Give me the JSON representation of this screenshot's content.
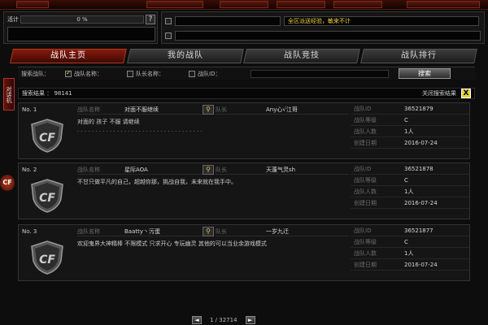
{
  "status": {
    "name_label": "活计",
    "percent": "0 %",
    "help_label": "?",
    "speaker_text": "全区派送经验，敏来不计"
  },
  "tabs": [
    {
      "label": "战队主页",
      "active": true
    },
    {
      "label": "我的战队",
      "active": false
    },
    {
      "label": "战队竞技",
      "active": false
    },
    {
      "label": "战队排行",
      "active": false
    }
  ],
  "side_tab": "对讲机",
  "side_icon": "CF",
  "filter": {
    "label": "搜索战队：",
    "options": [
      {
        "label": "战队名称：",
        "checked": true
      },
      {
        "label": "队长名称：",
        "checked": false
      },
      {
        "label": "战队ID：",
        "checked": false
      }
    ],
    "search_button": "搜索"
  },
  "results": {
    "count_text": "搜索结果 ： 98141",
    "close_label": "关闭搜索结果",
    "close_icon": "X"
  },
  "field_labels": {
    "name": "战队名称",
    "leader": "队长",
    "id": "战队ID",
    "level": "战队等级",
    "members": "战队人数",
    "created": "创建日期"
  },
  "clans": [
    {
      "no": "No. 1",
      "name": "对面不服继续",
      "leader": "Any心√江哥",
      "note": "对面的  孩子   不服 请继续",
      "note2": ". . . . . . . . . . . . . . . . . . . . . . . . . . . . . . . . . . .",
      "id": "36521879",
      "level": "C",
      "members": "1人",
      "created": "2016-07-24"
    },
    {
      "no": "No. 2",
      "name": "星际AOA",
      "leader": "天蓬气灵sh",
      "note": "不甘只做平凡的自己，超越你那，挑战自我，未来就在我手中。",
      "note2": "",
      "id": "36521878",
      "level": "C",
      "members": "1人",
      "created": "2016-07-24"
    },
    {
      "no": "No. 3",
      "name": "Baatty丶污蛋",
      "leader": "一岁九迁",
      "note": "欢迎鬼界大神精棒    不限模式  只求开心   专玩幽灵  其他的可以当业余游戏模式",
      "note2": "",
      "id": "36521877",
      "level": "C",
      "members": "1人",
      "created": "2016-07-24"
    }
  ],
  "pager": {
    "text": "1 / 32714",
    "prev": "◄",
    "next": "►"
  }
}
